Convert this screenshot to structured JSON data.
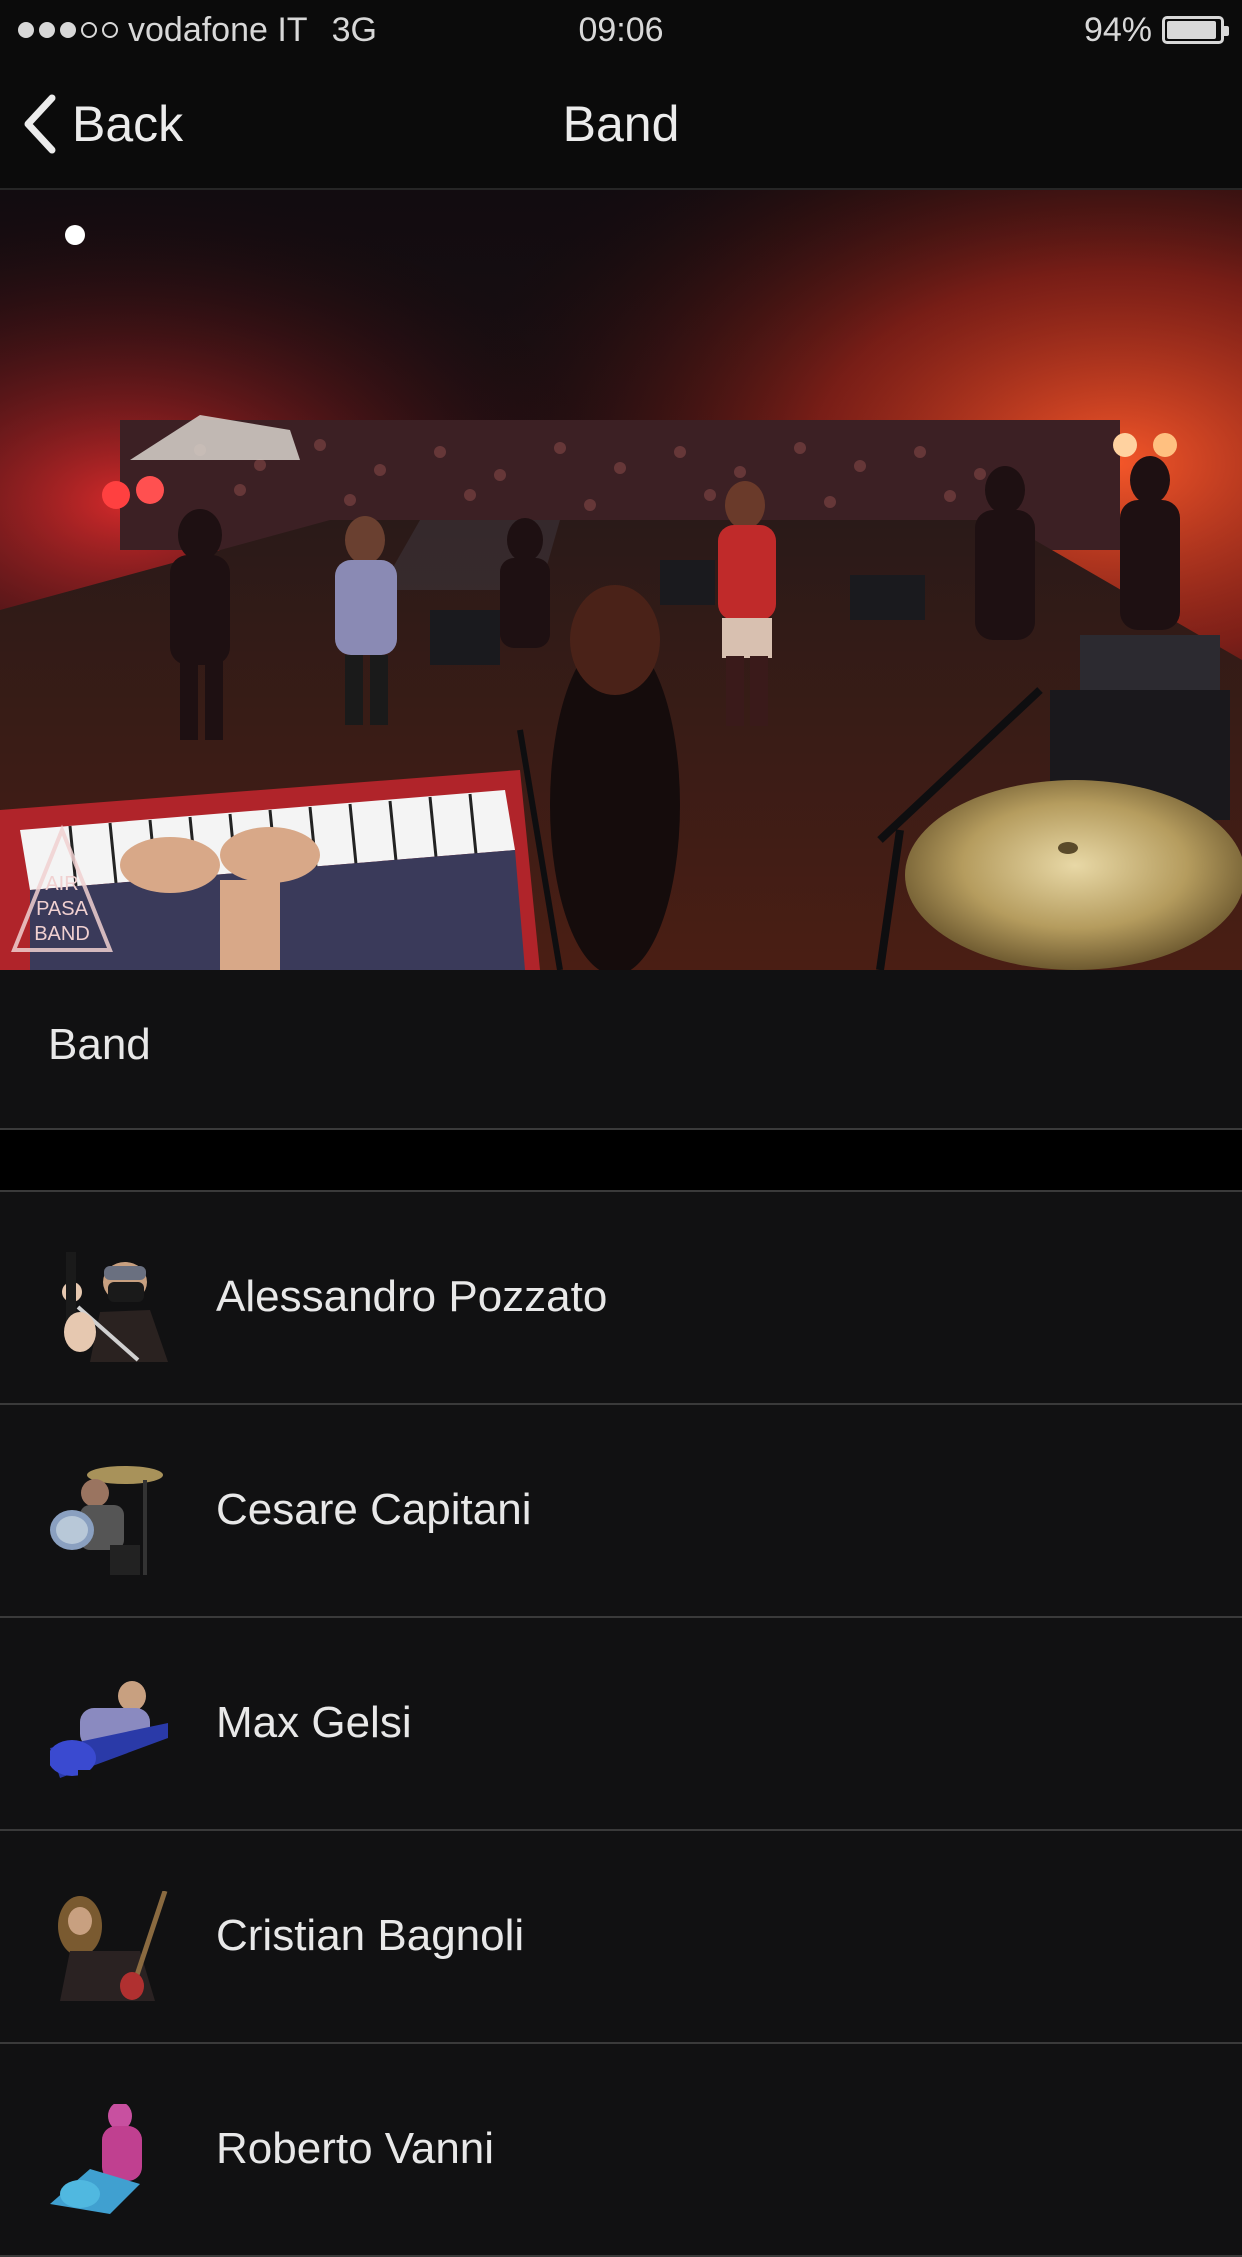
{
  "status_bar": {
    "carrier": "vodafone IT",
    "network": "3G",
    "time": "09:06",
    "battery_percent": "94%",
    "battery_level": 0.94
  },
  "nav": {
    "back_label": "Back",
    "title": "Band"
  },
  "hero": {
    "logo_lines": [
      "AIR",
      "PASA",
      "BAND"
    ]
  },
  "section": {
    "title": "Band"
  },
  "members": [
    {
      "name": "Alessandro Pozzato",
      "avatar_icon": "singer-with-microphone-icon"
    },
    {
      "name": "Cesare Capitani",
      "avatar_icon": "drummer-icon"
    },
    {
      "name": "Max Gelsi",
      "avatar_icon": "bassist-icon"
    },
    {
      "name": "Cristian Bagnoli",
      "avatar_icon": "guitarist-icon"
    },
    {
      "name": "Roberto Vanni",
      "avatar_icon": "guitarist-icon"
    }
  ],
  "colors": {
    "background": "#000000",
    "bar": "#0b0b0b",
    "cell": "#111112",
    "separator": "#3a3a3a",
    "text": "#e8e8e8"
  }
}
